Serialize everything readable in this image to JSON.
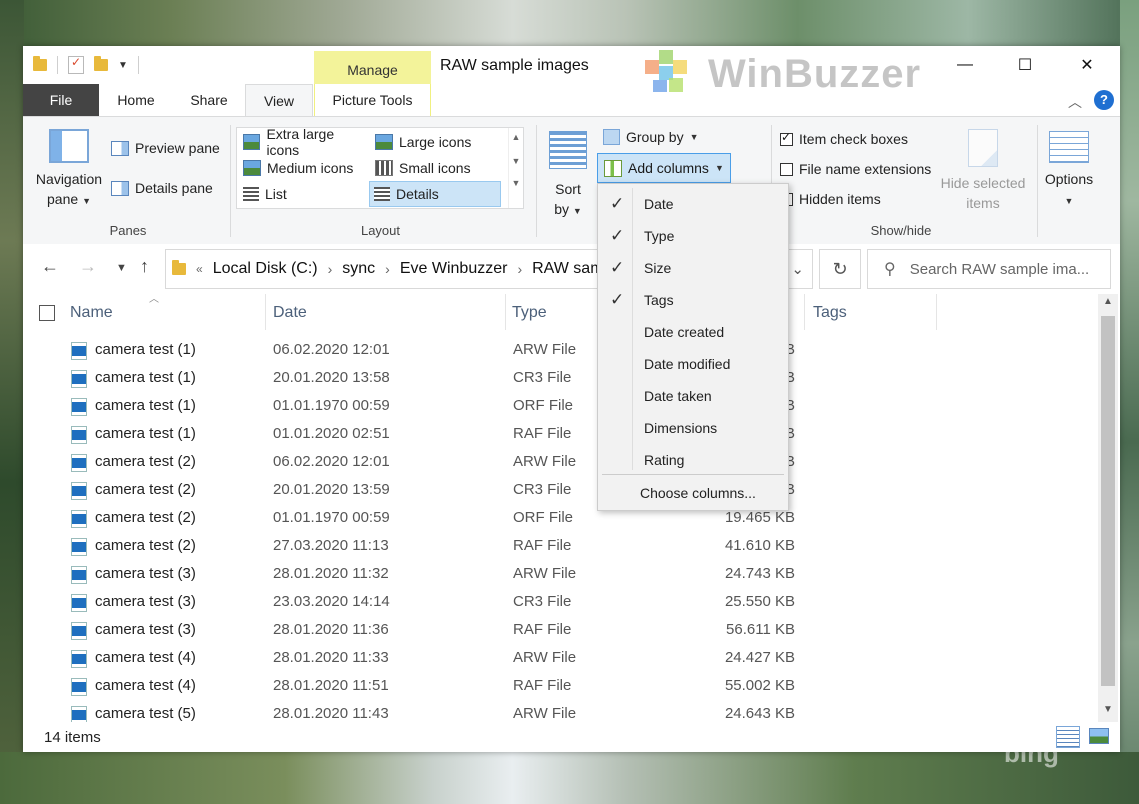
{
  "window": {
    "title": "RAW sample images",
    "context_tab": "Manage",
    "watermark": "WinBuzzer",
    "bing": "bing",
    "controls": {
      "minimize": "—",
      "maximize": "☐",
      "close": "✕"
    }
  },
  "tabs": [
    "File",
    "Home",
    "Share",
    "View",
    "Picture Tools"
  ],
  "ribbon": {
    "panes": {
      "navigation_pane_line1": "Navigation",
      "navigation_pane_line2": "pane",
      "preview_pane": "Preview pane",
      "details_pane": "Details pane",
      "group_label": "Panes"
    },
    "layout": {
      "items": [
        "Extra large icons",
        "Large icons",
        "Medium icons",
        "Small icons",
        "List",
        "Details"
      ],
      "selected": "Details",
      "group_label": "Layout"
    },
    "current_view": {
      "sort_line1": "Sort",
      "sort_line2": "by",
      "group_by": "Group by",
      "add_columns": "Add columns"
    },
    "show_hide": {
      "item_check_boxes": "Item check boxes",
      "item_check_boxes_checked": true,
      "file_name_extensions": "File name extensions",
      "file_name_extensions_checked": false,
      "hidden_items": "Hidden items",
      "hidden_items_checked": false,
      "hide_selected_line1": "Hide selected",
      "hide_selected_line2": "items",
      "group_label": "Show/hide"
    },
    "options": "Options"
  },
  "address": {
    "crumbs": [
      "Local Disk (C:)",
      "sync",
      "Eve Winbuzzer",
      "RAW samp"
    ],
    "prefix": "«",
    "search_placeholder": "Search RAW sample ima..."
  },
  "columns": [
    "Name",
    "Date",
    "Type",
    "Tags"
  ],
  "files": [
    {
      "name": "camera test (1)",
      "date": "06.02.2020 12:01",
      "type": "ARW File",
      "size": "B"
    },
    {
      "name": "camera test (1)",
      "date": "20.01.2020 13:58",
      "type": "CR3 File",
      "size": "B"
    },
    {
      "name": "camera test (1)",
      "date": "01.01.1970 00:59",
      "type": "ORF File",
      "size": "B"
    },
    {
      "name": "camera test (1)",
      "date": "01.01.2020 02:51",
      "type": "RAF File",
      "size": "B"
    },
    {
      "name": "camera test (2)",
      "date": "06.02.2020 12:01",
      "type": "ARW File",
      "size": "B"
    },
    {
      "name": "camera test (2)",
      "date": "20.01.2020 13:59",
      "type": "CR3 File",
      "size": "B"
    },
    {
      "name": "camera test (2)",
      "date": "01.01.1970 00:59",
      "type": "ORF File",
      "size": "19.465 KB"
    },
    {
      "name": "camera test (2)",
      "date": "27.03.2020 11:13",
      "type": "RAF File",
      "size": "41.610 KB"
    },
    {
      "name": "camera test (3)",
      "date": "28.01.2020 11:32",
      "type": "ARW File",
      "size": "24.743 KB"
    },
    {
      "name": "camera test (3)",
      "date": "23.03.2020 14:14",
      "type": "CR3 File",
      "size": "25.550 KB"
    },
    {
      "name": "camera test (3)",
      "date": "28.01.2020 11:36",
      "type": "RAF File",
      "size": "56.611 KB"
    },
    {
      "name": "camera test (4)",
      "date": "28.01.2020 11:33",
      "type": "ARW File",
      "size": "24.427 KB"
    },
    {
      "name": "camera test (4)",
      "date": "28.01.2020 11:51",
      "type": "RAF File",
      "size": "55.002 KB"
    },
    {
      "name": "camera test (5)",
      "date": "28.01.2020 11:43",
      "type": "ARW File",
      "size": "24.643 KB"
    }
  ],
  "status": {
    "item_count": "14 items"
  },
  "dropdown": {
    "items": [
      {
        "label": "Date",
        "checked": true
      },
      {
        "label": "Type",
        "checked": true
      },
      {
        "label": "Size",
        "checked": true
      },
      {
        "label": "Tags",
        "checked": true
      },
      {
        "label": "Date created",
        "checked": false
      },
      {
        "label": "Date modified",
        "checked": false
      },
      {
        "label": "Date taken",
        "checked": false
      },
      {
        "label": "Dimensions",
        "checked": false
      },
      {
        "label": "Rating",
        "checked": false
      }
    ],
    "choose": "Choose columns..."
  },
  "colors": {
    "accent": "#0078d7",
    "manage_tab": "#f3f39a",
    "selection": "#cce4f7"
  }
}
